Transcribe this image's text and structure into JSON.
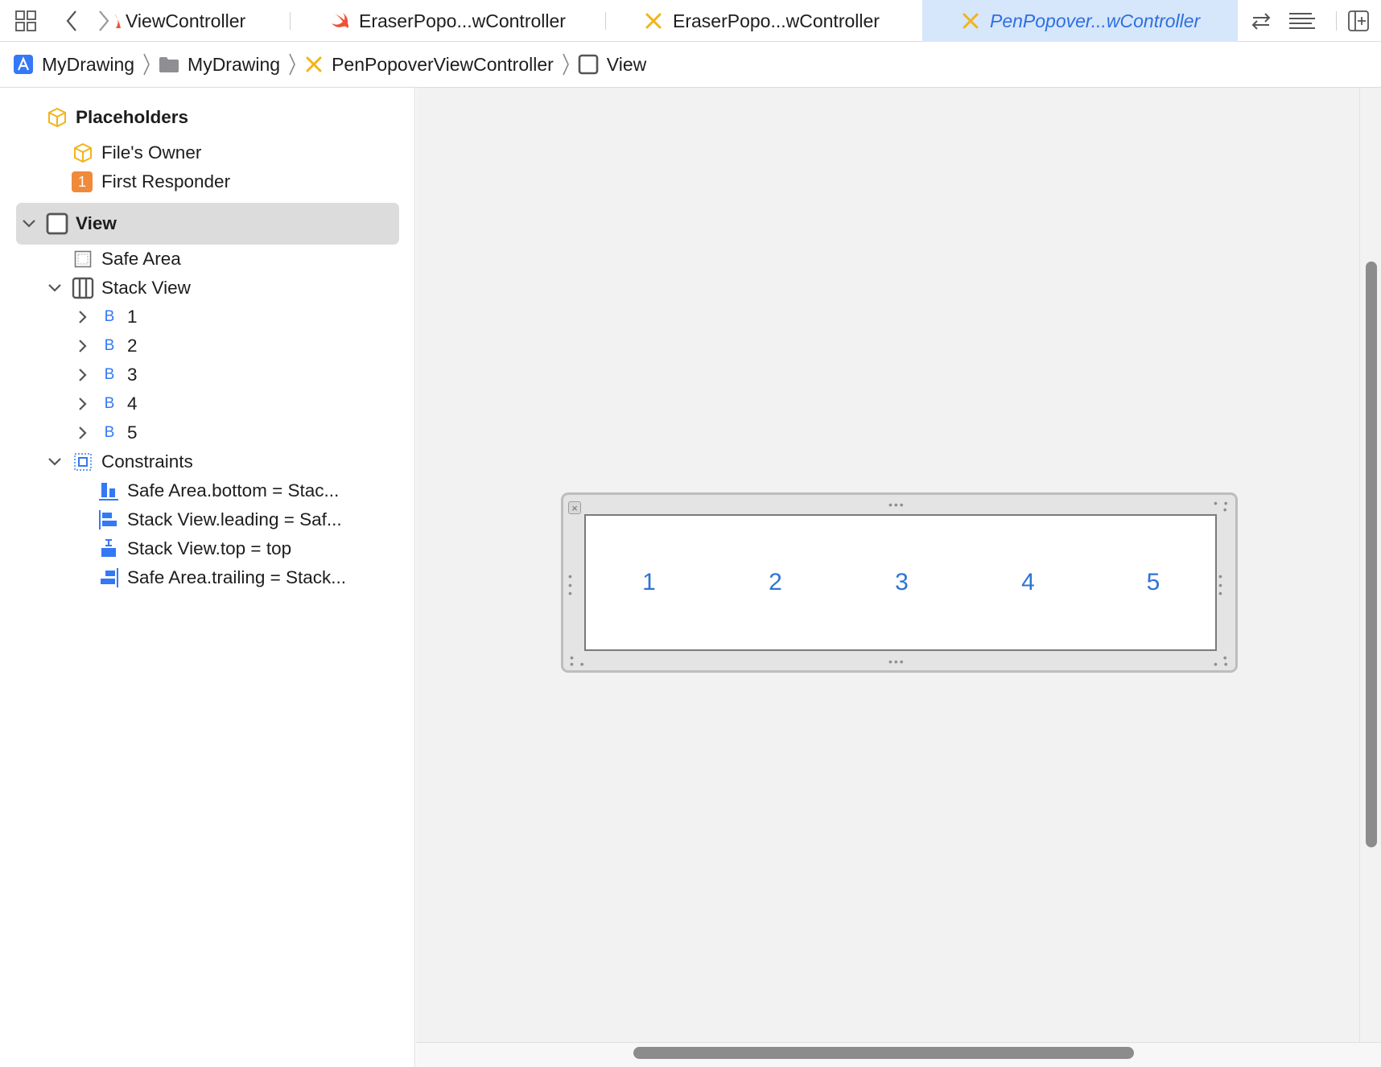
{
  "tabbar": {
    "tabs": [
      {
        "label": "ViewController",
        "icon": "swift-icon",
        "active": false
      },
      {
        "label": "EraserPopo...wController",
        "icon": "swift-icon",
        "active": false
      },
      {
        "label": "EraserPopo...wController",
        "icon": "interface-builder-icon",
        "active": false
      },
      {
        "label": "PenPopover...wController",
        "icon": "interface-builder-icon",
        "active": true
      }
    ]
  },
  "jumpbar": {
    "crumbs": [
      "MyDrawing",
      "MyDrawing",
      "PenPopoverViewController",
      "View"
    ]
  },
  "outline": {
    "placeholders_header": "Placeholders",
    "files_owner": "File's Owner",
    "first_responder_badge": "1",
    "first_responder": "First Responder",
    "view": "View",
    "safe_area": "Safe Area",
    "stack_view": "Stack View",
    "button_icon_letter": "B",
    "buttons": [
      "1",
      "2",
      "3",
      "4",
      "5"
    ],
    "constraints": "Constraints",
    "constraint_items": [
      "Safe Area.bottom = Stac...",
      "Stack View.leading = Saf...",
      "Stack View.top = top",
      "Safe Area.trailing = Stack..."
    ]
  },
  "canvas": {
    "scene_buttons": [
      "1",
      "2",
      "3",
      "4",
      "5"
    ]
  },
  "colors": {
    "accent_blue": "#3478f6",
    "active_tab_bg": "#d6e6fb",
    "ib_icon_yellow": "#f2b418",
    "swift_orange": "#f05138",
    "first_responder_orange": "#f08a3a",
    "selection_gray": "#dcdcdc"
  }
}
